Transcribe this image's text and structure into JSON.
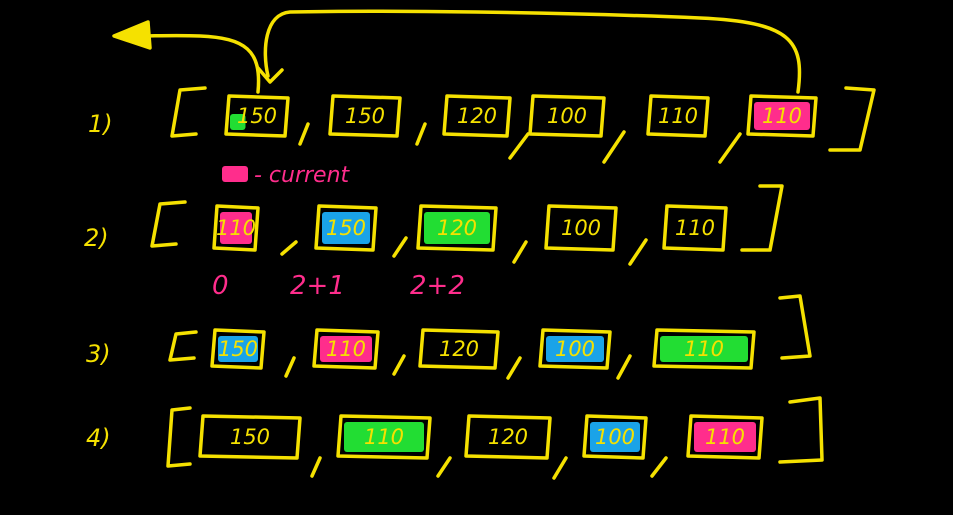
{
  "colors": {
    "background": "#000000",
    "ink": "#f5e100",
    "note": "#ff2d8c",
    "green": "#22dd33",
    "blue": "#1aa3e8",
    "pink": "#ff2d8c"
  },
  "rows": [
    {
      "label": "1)",
      "items": [
        {
          "value": "150",
          "highlight": "green-partial"
        },
        {
          "value": "150",
          "highlight": "none"
        },
        {
          "value": "120",
          "highlight": "none"
        },
        {
          "value": "100",
          "highlight": "none"
        },
        {
          "value": "110",
          "highlight": "none"
        },
        {
          "value": "110",
          "highlight": "pink"
        }
      ]
    },
    {
      "label": "2)",
      "items": [
        {
          "value": "110",
          "highlight": "pink"
        },
        {
          "value": "150",
          "highlight": "blue"
        },
        {
          "value": "120",
          "highlight": "green"
        },
        {
          "value": "100",
          "highlight": "none"
        },
        {
          "value": "110",
          "highlight": "none"
        }
      ]
    },
    {
      "label": "3)",
      "items": [
        {
          "value": "150",
          "highlight": "blue"
        },
        {
          "value": "110",
          "highlight": "pink"
        },
        {
          "value": "120",
          "highlight": "none"
        },
        {
          "value": "100",
          "highlight": "blue"
        },
        {
          "value": "110",
          "highlight": "green"
        }
      ]
    },
    {
      "label": "4)",
      "items": [
        {
          "value": "150",
          "highlight": "none"
        },
        {
          "value": "110",
          "highlight": "green"
        },
        {
          "value": "120",
          "highlight": "none"
        },
        {
          "value": "100",
          "highlight": "blue"
        },
        {
          "value": "110",
          "highlight": "pink"
        }
      ]
    }
  ],
  "legend": {
    "text": "- current",
    "swatch": "pink"
  },
  "index_labels": [
    "0",
    "2+1",
    "2+2"
  ]
}
